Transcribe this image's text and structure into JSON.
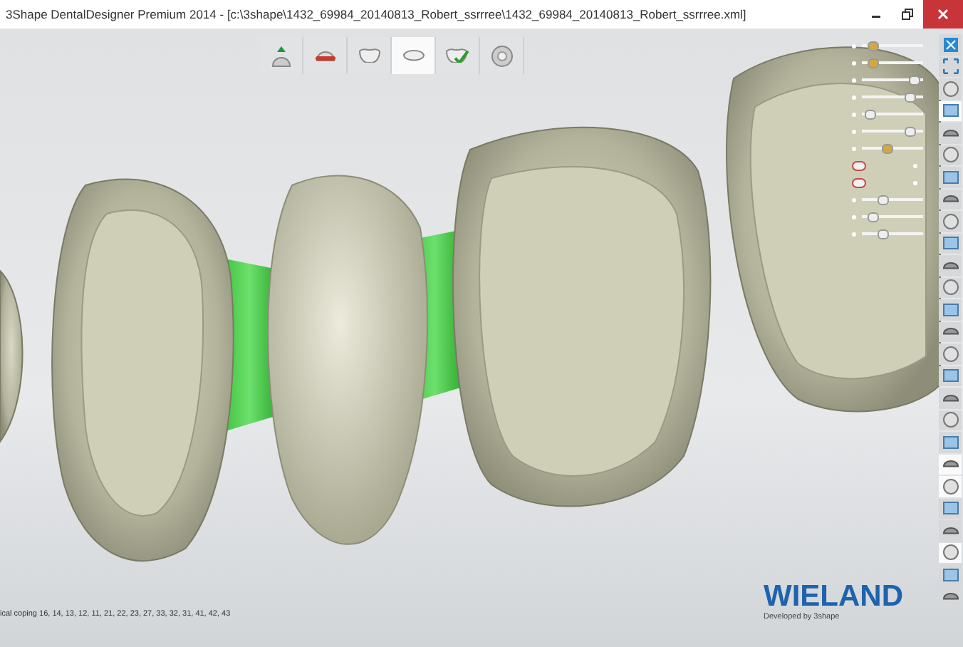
{
  "window": {
    "title": "3Shape DentalDesigner Premium 2014 - [c:\\3shape\\1432_69984_20140813_Robert_ssrrree\\1432_69984_20140813_Robert_ssrrree.xml]"
  },
  "workflow_steps": [
    {
      "selected": false
    },
    {
      "selected": false
    },
    {
      "selected": false
    },
    {
      "selected": true
    },
    {
      "selected": false
    },
    {
      "selected": false
    }
  ],
  "sliders": [
    {
      "kind": "slider",
      "level": 0.1
    },
    {
      "kind": "slider",
      "level": 0.1
    },
    {
      "kind": "slider",
      "level": 0.95
    },
    {
      "kind": "slider",
      "level": 0.85
    },
    {
      "kind": "slider",
      "level": 0.05
    },
    {
      "kind": "slider",
      "level": 0.85
    },
    {
      "kind": "slider",
      "level": 0.4
    },
    {
      "kind": "toggle"
    },
    {
      "kind": "toggle"
    },
    {
      "kind": "slider",
      "level": 0.3
    },
    {
      "kind": "slider",
      "level": 0.1
    },
    {
      "kind": "slider",
      "level": 0.3
    }
  ],
  "toolbar": [
    {
      "active": false
    },
    {
      "active": false
    },
    {
      "active": false
    },
    {
      "active": true
    },
    {
      "active": false
    },
    {
      "active": false
    },
    {
      "active": false
    },
    {
      "active": false
    },
    {
      "active": false
    },
    {
      "active": false
    },
    {
      "active": false
    },
    {
      "active": false
    },
    {
      "active": false
    },
    {
      "active": false
    },
    {
      "active": false
    },
    {
      "active": false
    },
    {
      "active": false
    },
    {
      "active": false
    },
    {
      "active": false
    },
    {
      "active": true
    },
    {
      "active": true
    },
    {
      "active": false
    },
    {
      "active": false
    },
    {
      "active": true
    },
    {
      "active": false
    },
    {
      "active": false
    }
  ],
  "status_bar": {
    "text": "ical coping 16, 14, 13, 12, 11, 21, 22, 23, 27, 33, 32, 31, 41, 42, 43"
  },
  "logo": {
    "name": "WIELAND",
    "tagline": "Developed by 3shape"
  }
}
